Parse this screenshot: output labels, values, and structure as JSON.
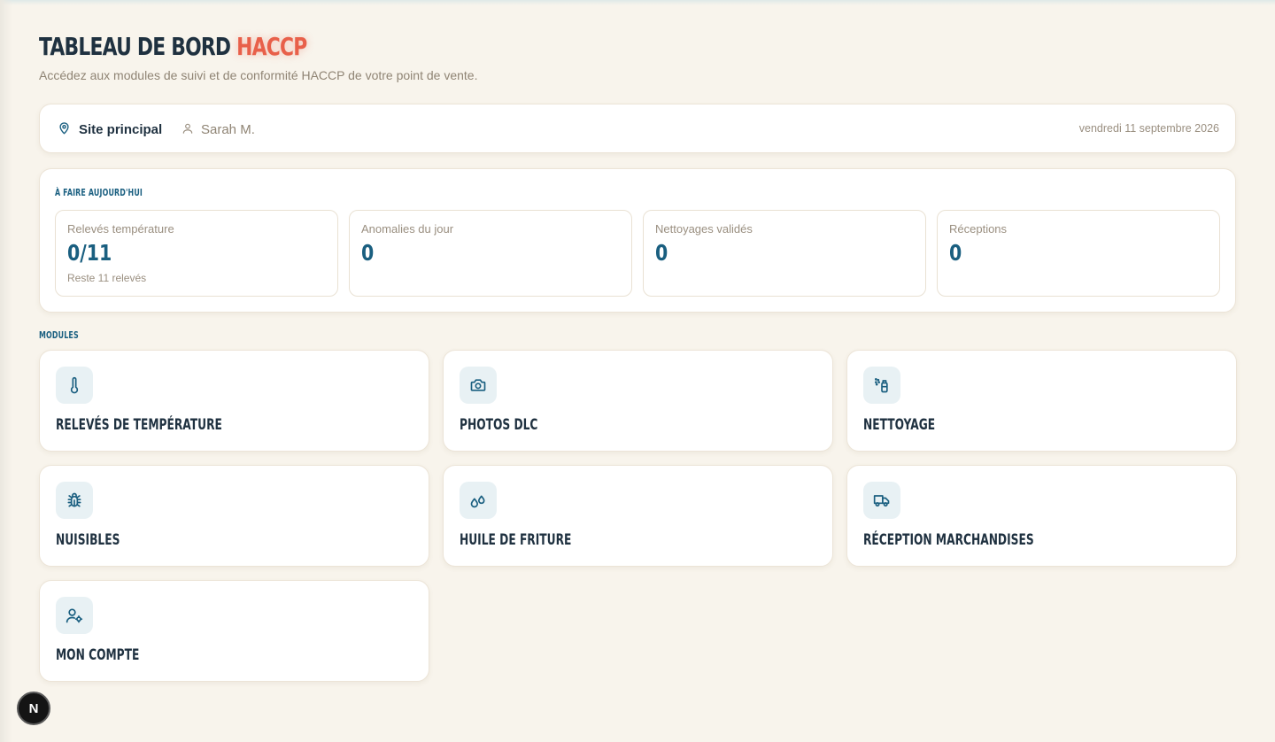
{
  "header": {
    "title_main": "TABLEAU DE BORD",
    "title_accent": "HACCP",
    "subtitle": "Accédez aux modules de suivi et de conformité HACCP de votre point de vente."
  },
  "context": {
    "site": "Site principal",
    "user": "Sarah M.",
    "date": "vendredi 11 septembre 2026"
  },
  "today": {
    "label": "À FAIRE AUJOURD'HUI",
    "stats": [
      {
        "label": "Relevés température",
        "value": "0/11",
        "hint": "Reste 11 relevés"
      },
      {
        "label": "Anomalies du jour",
        "value": "0",
        "hint": ""
      },
      {
        "label": "Nettoyages validés",
        "value": "0",
        "hint": ""
      },
      {
        "label": "Réceptions",
        "value": "0",
        "hint": ""
      }
    ]
  },
  "modules": {
    "label": "MODULES",
    "items": [
      {
        "title": "RELEVÉS DE TEMPÉRATURE",
        "icon": "thermometer-icon"
      },
      {
        "title": "PHOTOS DLC",
        "icon": "camera-icon"
      },
      {
        "title": "NETTOYAGE",
        "icon": "spray-bottle-icon"
      },
      {
        "title": "NUISIBLES",
        "icon": "bug-icon"
      },
      {
        "title": "HUILE DE FRITURE",
        "icon": "oil-drops-icon"
      },
      {
        "title": "RÉCEPTION MARCHANDISES",
        "icon": "truck-icon"
      },
      {
        "title": "MON COMPTE",
        "icon": "user-settings-icon"
      }
    ]
  },
  "dev_badge": {
    "letter": "N"
  },
  "colors": {
    "background": "#f8f4ec",
    "accent": "#e8604a",
    "primary": "#1a5f80",
    "text": "#1f3140",
    "muted": "#8f8474",
    "icon_bg": "#e8f1f4"
  }
}
